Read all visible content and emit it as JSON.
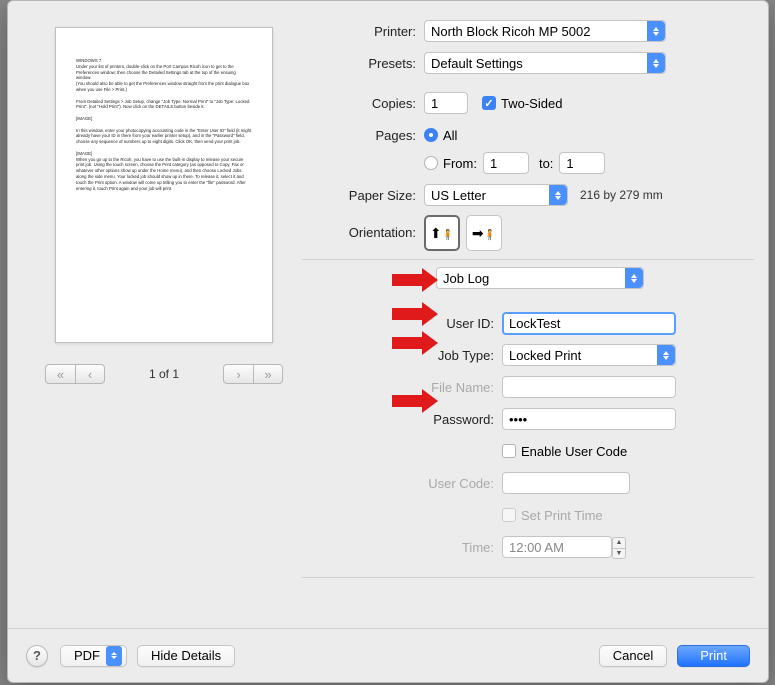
{
  "preview": {
    "text": "WINDOWS 7\nUnder your list of printers, double-click on the Port Campus Ricoh icon to get to the Preferences window; then choose the Detailed Settings tab at the top of the ensuing window.\n(You should also be able to get the Preferences window straight from the print dialogue box when you use File > Print.)\n\nFrom Detailed Settings > Job Setup, change \"Job Type: Normal Print\" to \"Job Type: Locked Print\". (not \"Hold Print\"). Now click on the DETAILS button beside it.\n\n[IMAGE]\n\nIn this window, enter your photocopying accounting code in the \"Enter User ID\" field (it might already have your ID in there from your earlier printer setup), and in the \"Password\" field, choose any sequence of numbers up to eight digits. Click OK, then send your print job.\n\n[IMAGE]\nWhen you go up to the Ricoh, you have to use the built-in display to release your secure print job. Using the touch screen, choose the Print category (as opposed to Copy, Fax or whatever other options show up under the Home menu), and then choose Locked Jobs along the side menu. Your locked job should show up in there. To release it, select it and touch the Print option. A window will come up telling you to enter the \"file\" password. After entering it, touch Print again and your job will print."
  },
  "pager": {
    "page_label": "1 of 1"
  },
  "labels": {
    "printer": "Printer:",
    "presets": "Presets:",
    "copies": "Copies:",
    "two_sided": "Two-Sided",
    "pages": "Pages:",
    "all": "All",
    "from": "From:",
    "to": "to:",
    "paper_size": "Paper Size:",
    "paper_dims": "216 by 279 mm",
    "orientation": "Orientation:",
    "user_id": "User ID:",
    "job_type": "Job Type:",
    "file_name": "File Name:",
    "password": "Password:",
    "enable_user_code": "Enable User Code",
    "user_code": "User Code:",
    "set_print_time": "Set Print Time",
    "time": "Time:"
  },
  "values": {
    "printer": "North Block Ricoh MP 5002",
    "presets": "Default Settings",
    "copies": "1",
    "two_sided_checked": true,
    "pages_all_selected": true,
    "from": "1",
    "to": "1",
    "paper_size": "US Letter",
    "section_dropdown": "Job Log",
    "user_id": "LockTest",
    "job_type": "Locked Print",
    "file_name": "",
    "password": "••••",
    "enable_user_code": false,
    "user_code": "",
    "set_print_time": false,
    "time": "12:00 AM"
  },
  "footer": {
    "pdf": "PDF",
    "hide_details": "Hide Details",
    "cancel": "Cancel",
    "print": "Print"
  }
}
